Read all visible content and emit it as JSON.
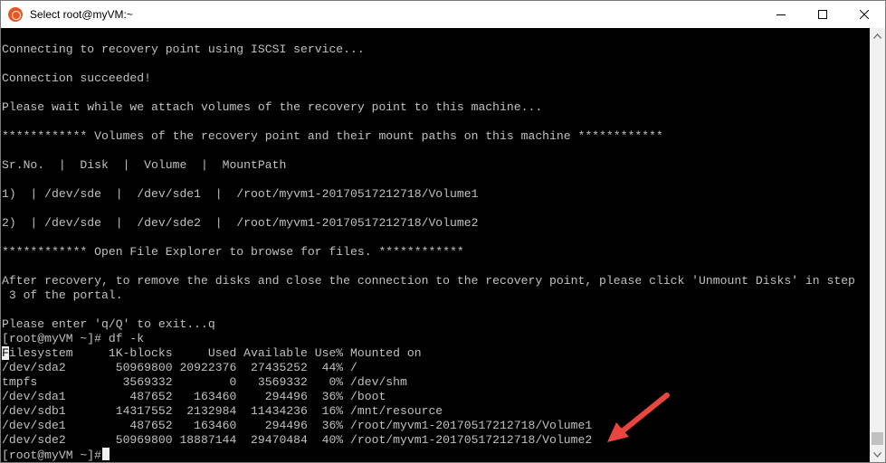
{
  "window": {
    "title": "Select root@myVM:~",
    "app_icon": "ubuntu-icon",
    "controls": [
      "minimize-icon",
      "maximize-icon",
      "close-icon"
    ]
  },
  "console": {
    "lines": [
      "",
      "Connecting to recovery point using ISCSI service...",
      "",
      "Connection succeeded!",
      "",
      "Please wait while we attach volumes of the recovery point to this machine...",
      "",
      "************ Volumes of the recovery point and their mount paths on this machine ************",
      "",
      "Sr.No.  |  Disk  |  Volume  |  MountPath",
      "",
      "1)  | /dev/sde  |  /dev/sde1  |  /root/myvm1-20170517212718/Volume1",
      "",
      "2)  | /dev/sde  |  /dev/sde2  |  /root/myvm1-20170517212718/Volume2",
      "",
      "************ Open File Explorer to browse for files. ************",
      "",
      "After recovery, to remove the disks and close the connection to the recovery point, please click 'Unmount Disks' in step",
      " 3 of the portal.",
      "",
      "Please enter 'q/Q' to exit...q",
      "[root@myVM ~]# df -k"
    ],
    "df_header_first_char": "F",
    "df_header_rest": "ilesystem     1K-blocks     Used Available Use% Mounted on",
    "df_rows": [
      "/dev/sda2       50969800 20922376  27435252  44% /",
      "tmpfs            3569332        0   3569332   0% /dev/shm",
      "/dev/sda1         487652   163460    294496  36% /boot",
      "/dev/sdb1       14317552  2132984  11434236  16% /mnt/resource",
      "/dev/sde1         487652   163460    294496  36% /root/myvm1-20170517212718/Volume1",
      "/dev/sde2       50969800 18887144  29470484  40% /root/myvm1-20170517212718/Volume2"
    ],
    "prompt": "[root@myVM ~]#"
  },
  "colors": {
    "console_bg": "#000000",
    "console_fg": "#c0c0c0",
    "annotation_arrow": "#e8473f"
  }
}
